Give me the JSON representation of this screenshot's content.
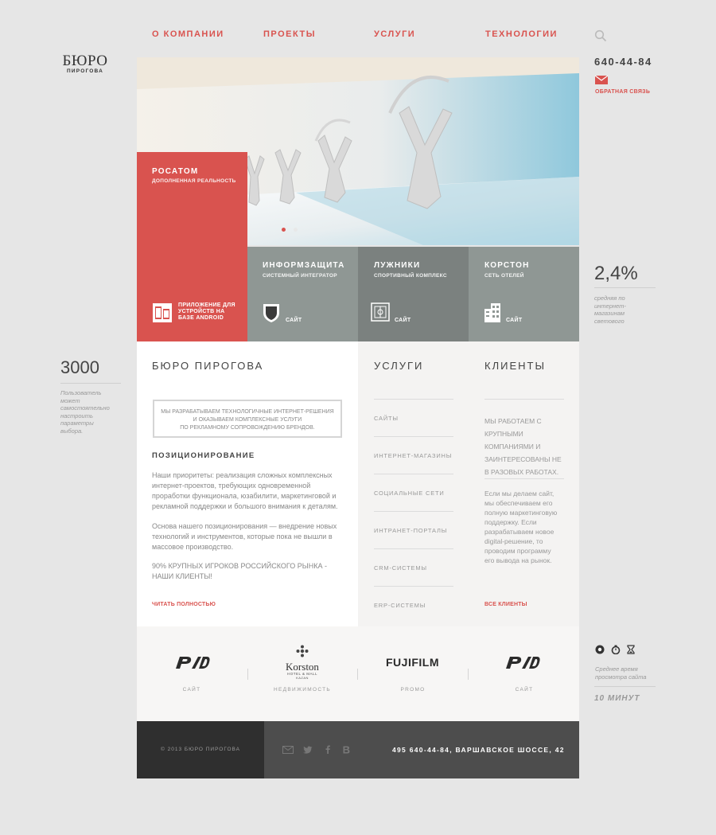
{
  "nav": {
    "items": [
      "О КОМПАНИИ",
      "ПРОЕКТЫ",
      "УСЛУГИ",
      "ТЕХНОЛОГИИ"
    ],
    "search_icon": "search-icon"
  },
  "logo": {
    "line1": "БЮРО",
    "line2": "ПИРОГОВА"
  },
  "contact": {
    "phone": "640-44-84",
    "feedback": "ОБРАТНАЯ СВЯЗЬ"
  },
  "hero": {
    "featured": {
      "title": "РОСАТОМ",
      "subtitle": "ДОПОЛНЕННАЯ РЕАЛЬНОСТЬ",
      "link": "ПРИЛОЖЕНИЕ ДЛЯ УСТРОЙСТВ НА БАЗЕ ANDROID",
      "color": "#d9534f"
    },
    "slide_count": 2,
    "active_slide": 1
  },
  "projects": [
    {
      "title": "ИНФОРМЗАЩИТА",
      "subtitle": "СИСТЕМНЫЙ ИНТЕГРАТОР",
      "link": "САЙТ",
      "icon": "shield-icon",
      "color": "#8f9794"
    },
    {
      "title": "ЛУЖНИКИ",
      "subtitle": "СПОРТИВНЫЙ КОМПЛЕКС",
      "link": "САЙТ",
      "icon": "stadium-icon",
      "color": "#7b817f"
    },
    {
      "title": "КОРСТОН",
      "subtitle": "СЕТЬ ОТЕЛЕЙ",
      "link": "САЙТ",
      "icon": "building-icon",
      "color": "#8f9794"
    }
  ],
  "stats": {
    "percent": "2,4%",
    "percent_note": [
      "средняя по",
      "интернет-",
      "магазинам",
      "светового"
    ],
    "count": "3000",
    "count_note": [
      "Пользователь",
      "может",
      "самостоятельно",
      "настроить",
      "параметры",
      "выбора."
    ],
    "time_note": [
      "Среднее время",
      "просмотра сайта"
    ],
    "time_value": "10 МИНУТ"
  },
  "about": {
    "heading": "БЮРО ПИРОГОВА",
    "quote": [
      "МЫ РАЗРАБАТЫВАЕМ ТЕХНОЛОГИЧНЫЕ ИНТЕРНЕТ-РЕШЕНИЯ",
      "И ОКАЗЫВАЕМ КОМПЛЕКСНЫЕ УСЛУГИ",
      "ПО РЕКЛАМНОМУ СОПРОВОЖДЕНИЮ БРЕНДОВ."
    ],
    "subheading": "ПОЗИЦИОНИРОВАНИЕ",
    "p1": [
      "Наши приоритеты: реализация сложных комплексных",
      "интернет-проектов, требующих одновременной",
      "проработки функционала, юзабилити, маркетинговой и",
      "рекламной поддержки и большого внимания к деталям."
    ],
    "p2": [
      "Основа нашего позиционирования — внедрение новых",
      "технологий и инструментов, которые пока не вышли в",
      "массовое производство."
    ],
    "p3": [
      "90% КРУПНЫХ ИГРОКОВ РОССИЙСКОГО РЫНКА -",
      "НАШИ КЛИЕНТЫ!"
    ],
    "more": "ЧИТАТЬ ПОЛНОСТЬЮ"
  },
  "services": {
    "heading": "УСЛУГИ",
    "items": [
      "САЙТЫ",
      "ИНТЕРНЕТ-МАГАЗИНЫ",
      "СОЦИАЛЬНЫЕ СЕТИ",
      "ИНТРАНЕТ-ПОРТАЛЫ",
      "CRM-СИСТЕМЫ",
      "ERP-СИСТЕМЫ"
    ]
  },
  "clients": {
    "heading": "КЛИЕНТЫ",
    "intro": [
      "МЫ РАБОТАЕМ С",
      "КРУПНЫМИ",
      "КОМПАНИЯМИ И",
      "ЗАИНТЕРЕСОВАНЫ НЕ",
      "В РАЗОВЫХ РАБОТАХ."
    ],
    "text": [
      "Если мы делаем сайт,",
      "мы обеспечиваем его",
      "полную маркетинговую",
      "поддержку. Если",
      "разрабатываем новое",
      "digital-решение, то",
      "проводим программу",
      "его вывода на рынок."
    ],
    "more": "ВСЕ КЛИЕНТЫ"
  },
  "partner_logos": [
    {
      "name": "РЖД",
      "caption": "САЙТ"
    },
    {
      "name": "Korston",
      "sub": "HOTEL & MALL",
      "city": "KAZAN",
      "caption": "НЕДВИЖИМОСТЬ"
    },
    {
      "name": "FUJIFILM",
      "caption": "PROMO"
    },
    {
      "name": "РЖД",
      "caption": "САЙТ"
    }
  ],
  "footer": {
    "copyright": "© 2013 БЮРО ПИРОГОВА",
    "social_icons": [
      "mail-icon",
      "twitter-icon",
      "facebook-icon",
      "vkontakte-icon"
    ],
    "address": "495 640-44-84, ВАРШАВСКОЕ ШОССЕ, 42"
  },
  "colors": {
    "accent": "#d9534f",
    "text": "#444444",
    "muted": "#999999",
    "background": "#e6e6e6",
    "footer_dark": "#2f2f2f",
    "footer_mid": "#4d4d4d"
  }
}
